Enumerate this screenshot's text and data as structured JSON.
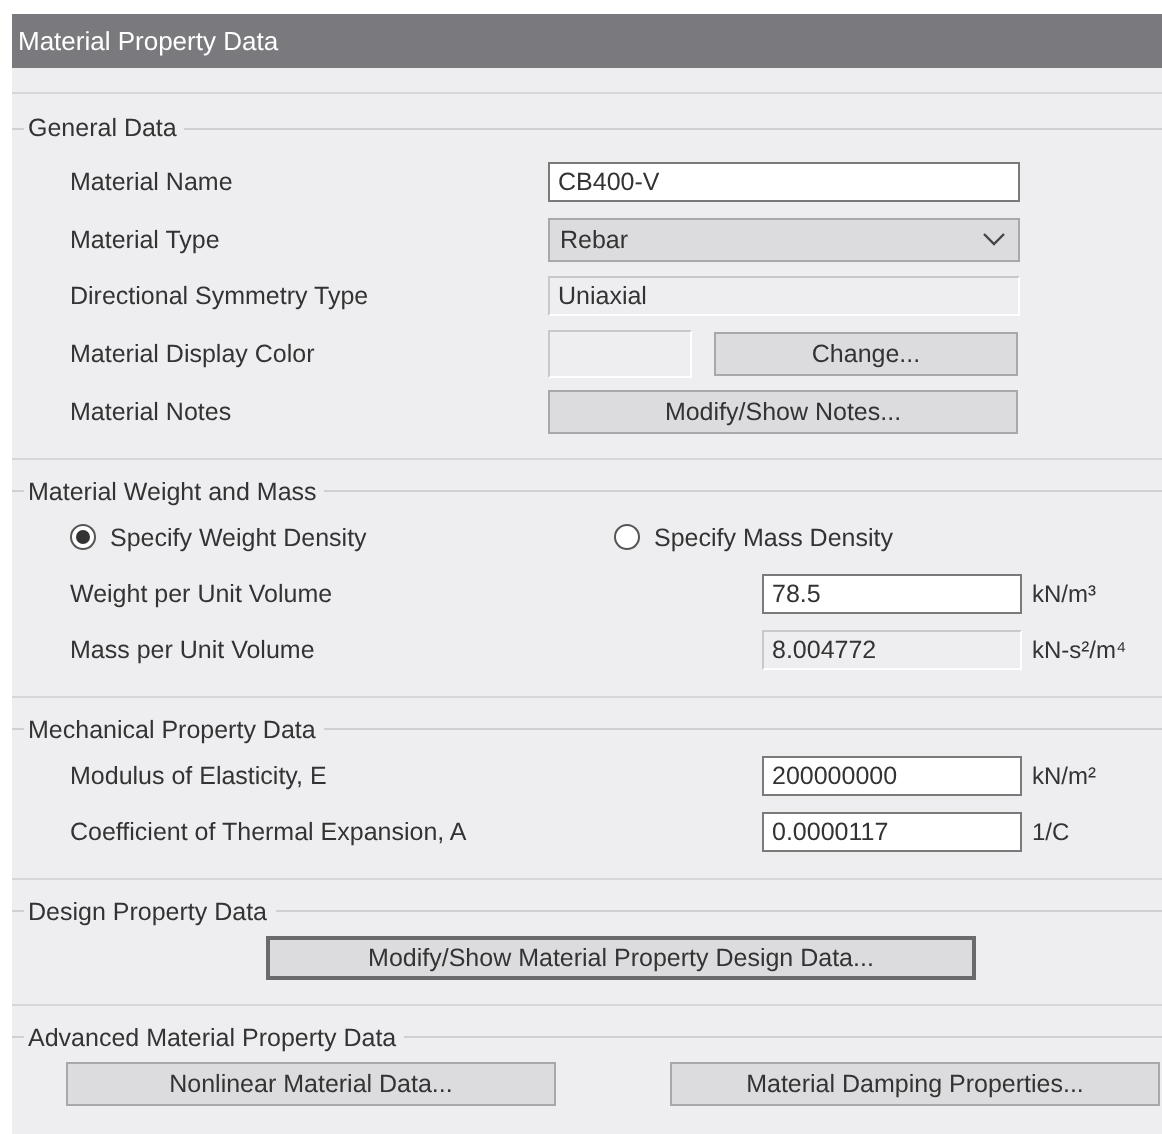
{
  "window": {
    "title": "Material Property Data"
  },
  "sections": [
    {
      "title": "General Data",
      "rows": [
        {
          "kind": "text_field",
          "label": "Material Name",
          "value": "CB400-V"
        },
        {
          "kind": "dropdown",
          "label": "Material Type",
          "value": "Rebar"
        },
        {
          "kind": "readonly_field",
          "label": "Directional Symmetry Type",
          "value": "Uniaxial"
        },
        {
          "kind": "color_button",
          "label": "Material Display Color",
          "button": "Change..."
        },
        {
          "kind": "button",
          "label": "Material Notes",
          "button": "Modify/Show Notes..."
        }
      ]
    },
    {
      "title": "Material Weight and Mass",
      "rows": [
        {
          "kind": "radio_group",
          "options": [
            {
              "label": "Specify Weight Density",
              "selected": true
            },
            {
              "label": "Specify Mass Density",
              "selected": false
            }
          ]
        },
        {
          "kind": "unit_field",
          "label": "Weight per Unit Volume",
          "value": "78.5",
          "unit": "kN/m³",
          "disabled": false
        },
        {
          "kind": "unit_field",
          "label": "Mass per Unit Volume",
          "value": "8.004772",
          "unit": "kN-s²/m⁴",
          "disabled": true
        }
      ]
    },
    {
      "title": "Mechanical Property Data",
      "rows": [
        {
          "kind": "unit_field",
          "label": "Modulus of Elasticity,  E",
          "value": "200000000",
          "unit": "kN/m²",
          "disabled": false
        },
        {
          "kind": "unit_field",
          "label": "Coefficient of Thermal Expansion,  A",
          "value": "0.0000117",
          "unit": "1/C",
          "disabled": false
        }
      ]
    },
    {
      "title": "Design Property Data",
      "rows": [
        {
          "kind": "center_button",
          "button": "Modify/Show Material Property Design Data...",
          "default": true
        }
      ]
    },
    {
      "title": "Advanced Material Property Data",
      "rows": [
        {
          "kind": "button_pair",
          "buttons": [
            "Nonlinear Material Data...",
            "Material Damping Properties..."
          ]
        }
      ]
    }
  ]
}
